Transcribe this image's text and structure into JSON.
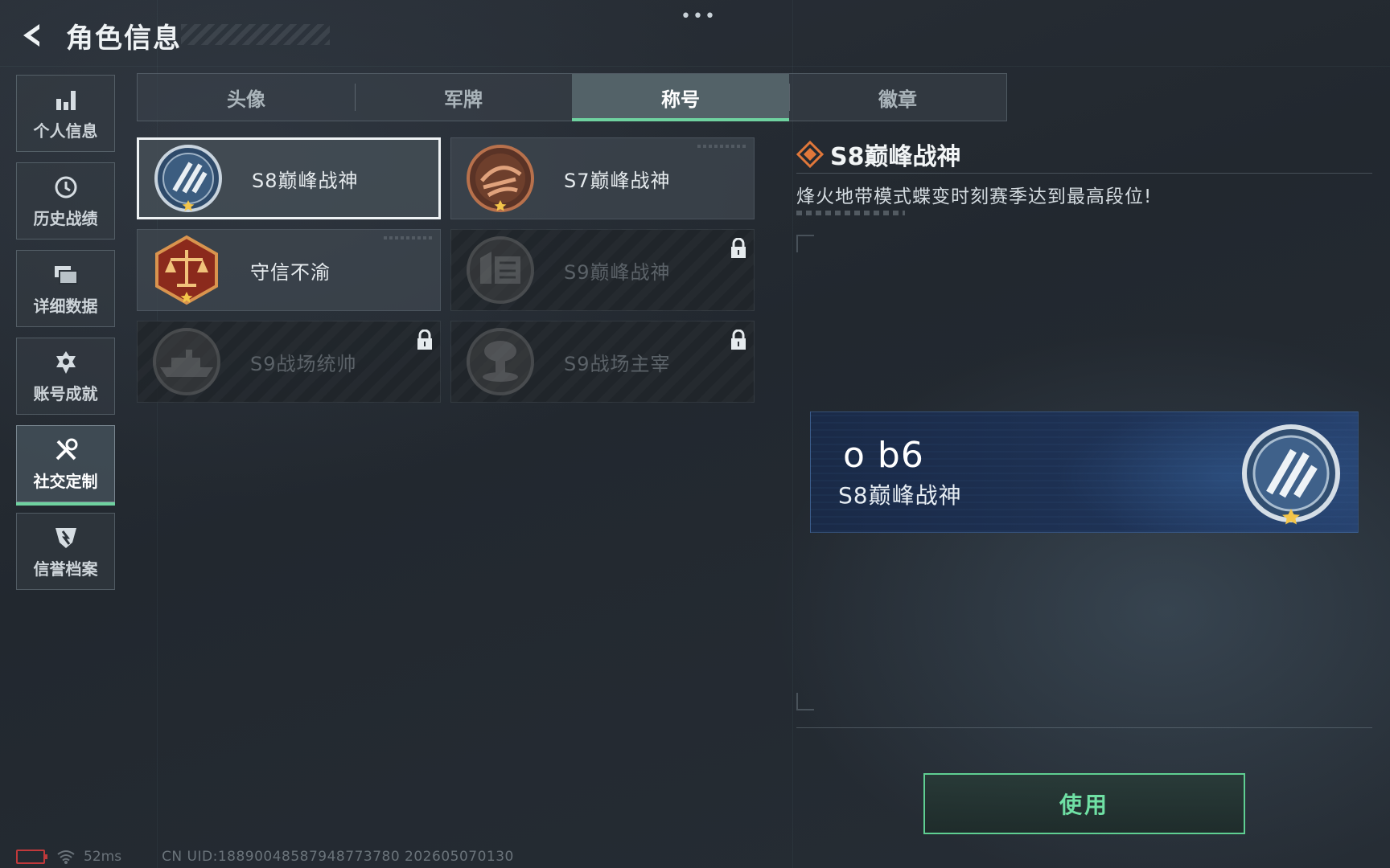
{
  "header": {
    "title": "角色信息",
    "menu_dots": "•••"
  },
  "sidebar": {
    "items": [
      {
        "label": "个人信息",
        "icon": "bar-chart-icon",
        "active": false
      },
      {
        "label": "历史战绩",
        "icon": "history-icon",
        "active": false
      },
      {
        "label": "详细数据",
        "icon": "folder-icon",
        "active": false
      },
      {
        "label": "账号成就",
        "icon": "achievement-icon",
        "active": false
      },
      {
        "label": "社交定制",
        "icon": "tools-icon",
        "active": true
      },
      {
        "label": "信誉档案",
        "icon": "credit-shield-icon",
        "active": false
      }
    ]
  },
  "tabs": [
    {
      "label": "头像",
      "active": false
    },
    {
      "label": "军牌",
      "active": false
    },
    {
      "label": "称号",
      "active": true
    },
    {
      "label": "徽章",
      "active": false
    }
  ],
  "titles": [
    {
      "name": "S8巅峰战神",
      "medal": "silver-wing-medal",
      "selected": true,
      "locked": false
    },
    {
      "name": "S7巅峰战神",
      "medal": "bronze-wing-medal",
      "selected": false,
      "locked": false
    },
    {
      "name": "守信不渝",
      "medal": "justice-scale-medal",
      "selected": false,
      "locked": false
    },
    {
      "name": "S9巅峰战神",
      "medal": "fortress-medal",
      "selected": false,
      "locked": true
    },
    {
      "name": "S9战场统帅",
      "medal": "warship-medal",
      "selected": false,
      "locked": true
    },
    {
      "name": "S9战场主宰",
      "medal": "mushroom-cloud-medal",
      "selected": false,
      "locked": true
    }
  ],
  "detail": {
    "title": "S8巅峰战神",
    "description": "烽火地带模式蝶变时刻赛季达到最高段位!"
  },
  "preview": {
    "player_name": "o b6",
    "title": "S8巅峰战神"
  },
  "use_button": "使用",
  "status_bar": {
    "ping": "52ms",
    "uid": "CN UID:188900485879487737​80 202605070130"
  },
  "colors": {
    "accent_green": "#6fd2a0",
    "detail_diamond": "#e0773a",
    "lock_disabled": "#5b6268"
  }
}
